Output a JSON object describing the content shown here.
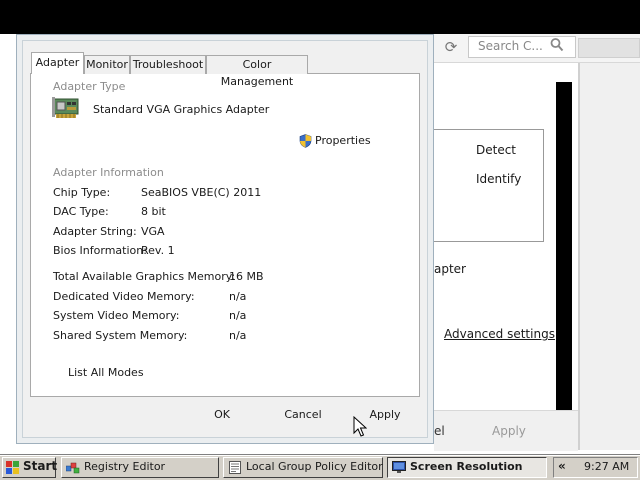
{
  "background_window": {
    "search_placeholder": "Search C...",
    "detect_label": "Detect",
    "identify_label": "Identify",
    "adapter_partial": "apter",
    "advanced_settings_label": "Advanced settings",
    "cancel_partial": "el",
    "apply_label": "Apply"
  },
  "dialog": {
    "tabs": [
      {
        "label": "Adapter",
        "active": true
      },
      {
        "label": "Monitor",
        "active": false
      },
      {
        "label": "Troubleshoot",
        "active": false
      },
      {
        "label": "Color Management",
        "active": false
      }
    ],
    "adapter_type": {
      "title": "Adapter Type",
      "name": "Standard VGA Graphics Adapter",
      "properties_label": "Properties"
    },
    "adapter_info": {
      "title": "Adapter Information",
      "rows": [
        {
          "label": "Chip Type:",
          "value": "SeaBIOS VBE(C) 2011"
        },
        {
          "label": "DAC Type:",
          "value": "8 bit"
        },
        {
          "label": "Adapter String:",
          "value": "VGA"
        },
        {
          "label": "Bios Information:",
          "value": "Rev. 1"
        }
      ]
    },
    "memory": [
      {
        "label": "Total Available Graphics Memory:",
        "value": "16 MB"
      },
      {
        "label": "Dedicated Video Memory:",
        "value": "n/a"
      },
      {
        "label": "System Video Memory:",
        "value": "n/a"
      },
      {
        "label": "Shared System Memory:",
        "value": "n/a"
      }
    ],
    "list_all_modes_label": "List All Modes",
    "ok_label": "OK",
    "cancel_label": "Cancel",
    "apply_label": "Apply"
  },
  "taskbar": {
    "start_label": "Start",
    "items": [
      {
        "label": "Registry Editor",
        "icon": "registry-editor-icon",
        "active": false
      },
      {
        "label": "Local Group Policy Editor",
        "icon": "policy-document-icon",
        "active": false
      },
      {
        "label": "Screen Resolution",
        "icon": "monitor-icon",
        "active": true
      }
    ],
    "tray_chevron": "«",
    "clock": "9:27 AM"
  },
  "colors": {
    "taskbar": "#d4d0c8",
    "dialog_bg": "#f0f0f0",
    "group_title": "#8c8c8c",
    "top_band": "#000000"
  }
}
